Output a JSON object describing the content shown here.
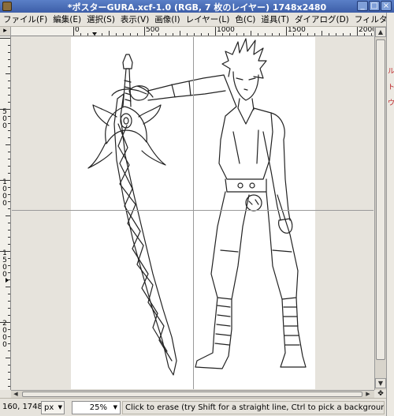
{
  "window": {
    "title": "*ポスターGURA.xcf-1.0 (RGB, 7 枚のレイヤー) 1748x2480",
    "buttons": [
      "_",
      "□",
      "×"
    ]
  },
  "menubar": {
    "items": [
      "ファイル(F)",
      "編集(E)",
      "選択(S)",
      "表示(V)",
      "画像(I)",
      "レイヤー(L)",
      "色(C)",
      "道具(T)",
      "ダイアログ(D)",
      "フィルタ(R)"
    ]
  },
  "rulers": {
    "corner_glyph": "▸",
    "horizontal_labels": [
      "0",
      "500",
      "1000",
      "1500",
      "2000"
    ],
    "vertical_labels": [
      "500",
      "1000",
      "1500",
      "2000"
    ]
  },
  "scrollbars": {
    "up_arrow": "▲",
    "down_arrow": "▼",
    "left_arrow": "◀",
    "right_arrow": "▶",
    "nav_glyph": "✥"
  },
  "statusbar": {
    "coords": "160, 1748",
    "unit": "px",
    "zoom": "25%",
    "message": "Click to erase (try Shift for a straight line, Ctrl to pick a background color)",
    "caret": "▼"
  },
  "right_strip": {
    "fragments": [
      "ル",
      "ト",
      "ウ"
    ]
  },
  "colors": {
    "titlebar": "#4a6eb8",
    "canvas_bg": "#e6e3dc",
    "image_bg": "#ffffff",
    "guide": "#9a9a9a"
  }
}
